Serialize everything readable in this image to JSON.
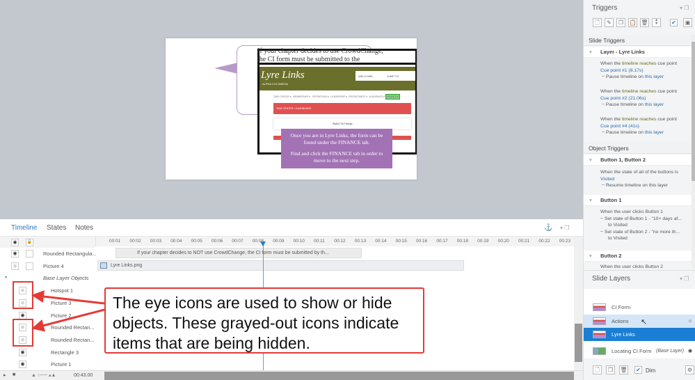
{
  "slide": {
    "bubble_text_1": "If your chapter decides to use CrowdChange,",
    "bubble_text_2": "the CI form must be submitted to the",
    "site_logo": "Lyre Links",
    "site_sub": "ALPHA CHI OMEGA",
    "welcome": "WELCOME,",
    "jump": "JUMP TO",
    "menu": [
      "TASK CENTER ▾",
      "MEMBERSHIP ▾",
      "OPERATIONS ▾",
      "LEADERSHIP ▾",
      "RECRUITMENT ▾",
      "ACADEMICS ▾",
      "FINANCE ▾"
    ],
    "breadcrumb": "TASK CENTER  >  DASHBOARD",
    "org": "Alpha Chi Omega",
    "purple_1": "Once you are in Lyre Links, the form can be found under the FINANCE tab.",
    "purple_2": "Find and click the FINANCE tab in order to move to the next step."
  },
  "timeline": {
    "tabs": [
      "Timeline",
      "States",
      "Notes"
    ],
    "rows": [
      {
        "label": "Rounded Rectangula...",
        "hidden": false,
        "italic": false
      },
      {
        "label": "Picture 4",
        "hidden": true
      },
      {
        "label": "Base Layer Objects",
        "group": true
      },
      {
        "label": "Hotspot 1",
        "hidden": true
      },
      {
        "label": "Picture 3",
        "hidden": true
      },
      {
        "label": "Picture 2",
        "hidden": false
      },
      {
        "label": "Rounded Rectan...",
        "hidden": true
      },
      {
        "label": "Rounded Rectan...",
        "hidden": true
      },
      {
        "label": "Rectangle 3",
        "hidden": false
      },
      {
        "label": "Picture 1",
        "hidden": false
      }
    ],
    "ticks": [
      "00:01",
      "00:02",
      "00:03",
      "00:04",
      "00:05",
      "00:06",
      "00:07",
      "00:08",
      "00:09",
      "00:10",
      "00:11",
      "00:12",
      "00:13",
      "00:14",
      "00:15",
      "00:16",
      "00:17",
      "00:18",
      "00:19",
      "00:20",
      "00:21",
      "00:22",
      "00:23"
    ],
    "bar_caption": "If your chapter decides to NOT use CrowdChange, the CI form must be submitted by th...",
    "bar_image": "Lyre Links.png",
    "duration": "00:43.00",
    "playhead_seconds": 8.2
  },
  "callout": "The eye icons are used to show or hide objects. These grayed-out icons indicate items that are being hidden.",
  "triggers": {
    "title": "Triggers",
    "slide_triggers": "Slide Triggers",
    "layer_heading": "Layer - Lyre Links",
    "layer_items": [
      {
        "cue": "Cue point #1 (8.17s)"
      },
      {
        "cue": "Cue point #2 (21.06s)"
      },
      {
        "cue": "Cue point #4 (41s)"
      }
    ],
    "when_tl_a": "When the ",
    "when_tl_b": "timeline reaches",
    "when_tl_c": " cue point",
    "pause_a": "− Pause timeline on ",
    "this_layer": "this layer",
    "object_triggers": "Object Triggers",
    "obj1": "Button 1, Button 2",
    "obj1_line1": "When the state of all of the buttons is",
    "obj1_line2": "Visited",
    "obj1_action": "− Resume timeline on this layer",
    "obj2": "Button 1",
    "obj2_line": "When the user clicks Button 1",
    "obj2_a1": "− Set state of Button 1 - \"10+ days af...",
    "obj2_a1b": "to Visited",
    "obj2_a2": "− Set state of Button 2 - \"no more th...",
    "obj2_a2b": "to Visited",
    "obj3": "Button 2",
    "obj3_line": "When the user clicks Button 2"
  },
  "layers": {
    "title": "Slide Layers",
    "items": [
      "CI Form",
      "Actions",
      "Lyre Links",
      "Locating CI Form"
    ],
    "base_tag": "(Base Layer)",
    "dim": "Dim"
  }
}
